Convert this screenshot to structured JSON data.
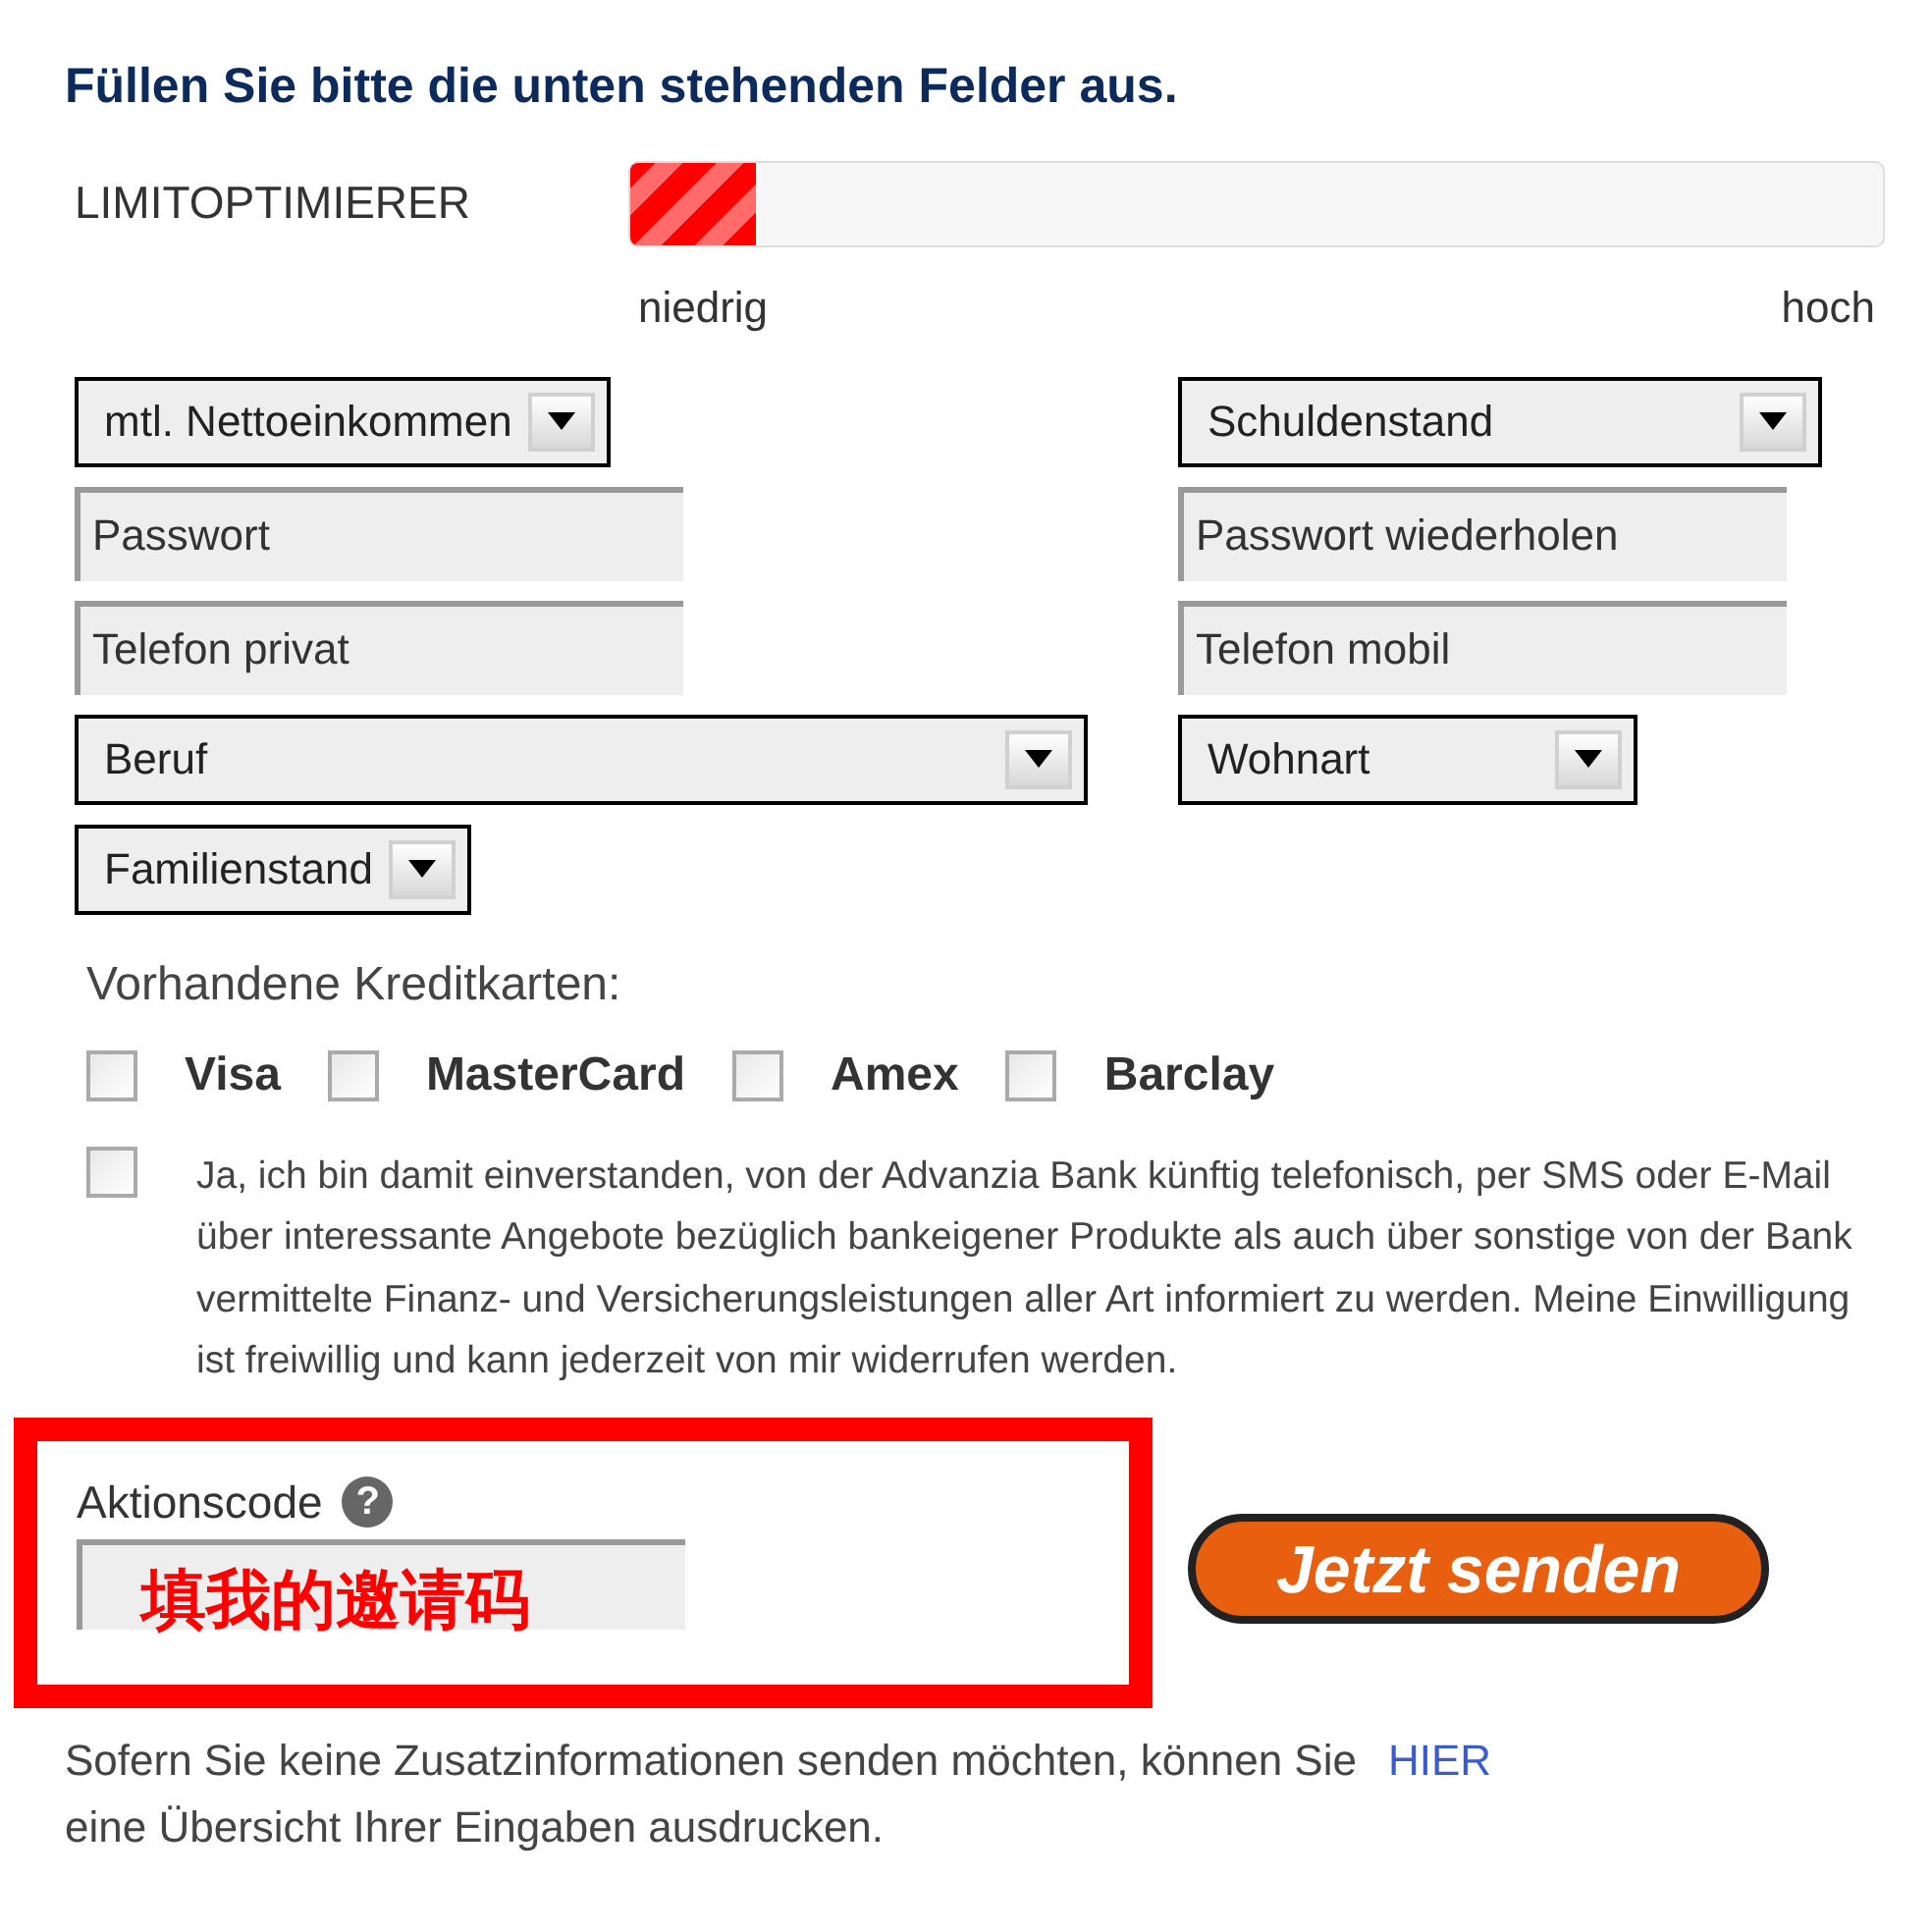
{
  "heading": "Füllen Sie bitte die unten stehenden Felder aus.",
  "limit": {
    "label": "LIMITOPTIMIERER",
    "level": 0.1,
    "low": "niedrig",
    "high": "hoch"
  },
  "rows": [
    {
      "items": [
        {
          "kind": "select",
          "label": "mtl. Nettoeinkommen"
        },
        {
          "kind": "select",
          "label": "Schuldenstand"
        }
      ]
    },
    {
      "items": [
        {
          "kind": "input",
          "placeholder": "Passwort"
        },
        {
          "kind": "input",
          "placeholder": "Passwort wiederholen"
        }
      ]
    },
    {
      "items": [
        {
          "kind": "input",
          "placeholder": "Telefon privat"
        },
        {
          "kind": "input",
          "placeholder": "Telefon mobil"
        }
      ]
    },
    {
      "items": [
        {
          "kind": "select",
          "label": "Beruf"
        },
        {
          "kind": "select",
          "label": "Wohnart"
        }
      ]
    },
    {
      "items": [
        {
          "kind": "select",
          "label": "Familienstand"
        }
      ]
    }
  ],
  "cards": {
    "label": "Vorhandene Kreditkarten:",
    "options": [
      {
        "label": "Visa",
        "checked": false
      },
      {
        "label": "MasterCard",
        "checked": false
      },
      {
        "label": "Amex",
        "checked": false
      },
      {
        "label": "Barclay",
        "checked": false
      }
    ]
  },
  "consent": {
    "checked": false,
    "text": "Ja, ich bin damit einverstanden, von der Advanzia Bank künftig telefonisch, per SMS oder E-Mail über interessante Angebote bezüglich bankeigener Produkte als auch über sonstige von der Bank vermittelte Finanz- und Versicherungsleistungen aller Art informiert zu werden. Meine Einwilligung ist freiwillig und kann jederzeit von mir widerrufen werden."
  },
  "promo": {
    "label": "Aktionscode",
    "help": "?",
    "annotation": "填我的邀请码"
  },
  "submit": "Jetzt senden",
  "footer": {
    "text": "Sofern Sie keine Zusatzinformationen senden möchten, können Sie",
    "link": "HIER",
    "text2": "eine Übersicht Ihrer Eingaben ausdrucken."
  }
}
